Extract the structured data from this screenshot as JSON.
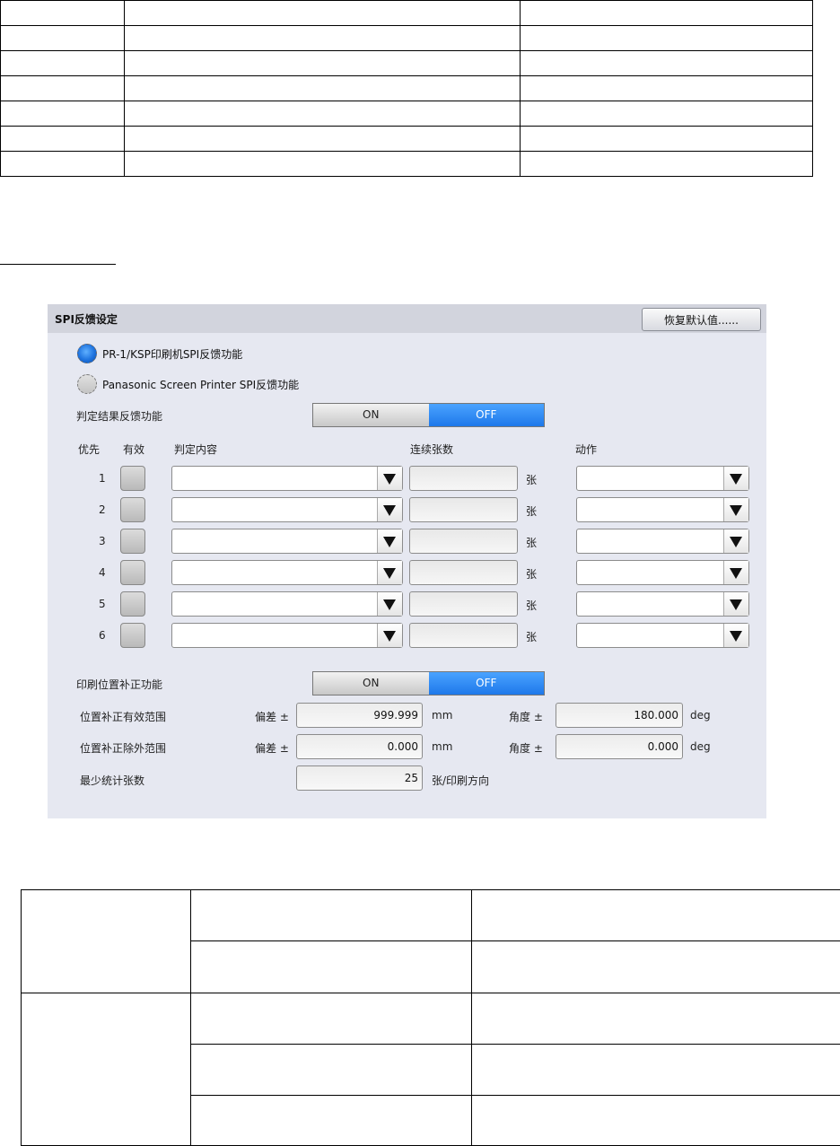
{
  "panel": {
    "title": "SPI反馈设定",
    "restore_button": "恢复默认值......",
    "radio_options": [
      {
        "label": "PR-1/KSP印刷机SPI反馈功能",
        "selected": true
      },
      {
        "label": "Panasonic Screen Printer SPI反馈功能",
        "selected": false
      }
    ],
    "judgement_feedback": {
      "label": "判定结果反馈功能",
      "on": "ON",
      "off": "OFF",
      "active": "OFF"
    },
    "headers": {
      "priority": "优先",
      "valid": "有效",
      "content": "判定内容",
      "count": "连续张数",
      "action": "动作"
    },
    "rows": [
      {
        "priority": "1",
        "unit": "张"
      },
      {
        "priority": "2",
        "unit": "张"
      },
      {
        "priority": "3",
        "unit": "张"
      },
      {
        "priority": "4",
        "unit": "张"
      },
      {
        "priority": "5",
        "unit": "张"
      },
      {
        "priority": "6",
        "unit": "张"
      }
    ],
    "position_correction": {
      "label": "印刷位置补正功能",
      "on": "ON",
      "off": "OFF",
      "active": "OFF"
    },
    "valid_range": {
      "label": "位置补正有效范围",
      "offset_label": "偏差 ±",
      "offset_value": "999.999",
      "offset_unit": "mm",
      "angle_label": "角度 ±",
      "angle_value": "180.000",
      "angle_unit": "deg"
    },
    "excluded_range": {
      "label": "位置补正除外范围",
      "offset_label": "偏差 ±",
      "offset_value": "0.000",
      "offset_unit": "mm",
      "angle_label": "角度 ±",
      "angle_value": "0.000",
      "angle_unit": "deg"
    },
    "min_count": {
      "label": "最少统计张数",
      "value": "25",
      "unit": "张/印刷方向"
    }
  },
  "colors": {
    "panel_bg": "#e6e8f1",
    "accent_blue": "#1e78ea"
  }
}
